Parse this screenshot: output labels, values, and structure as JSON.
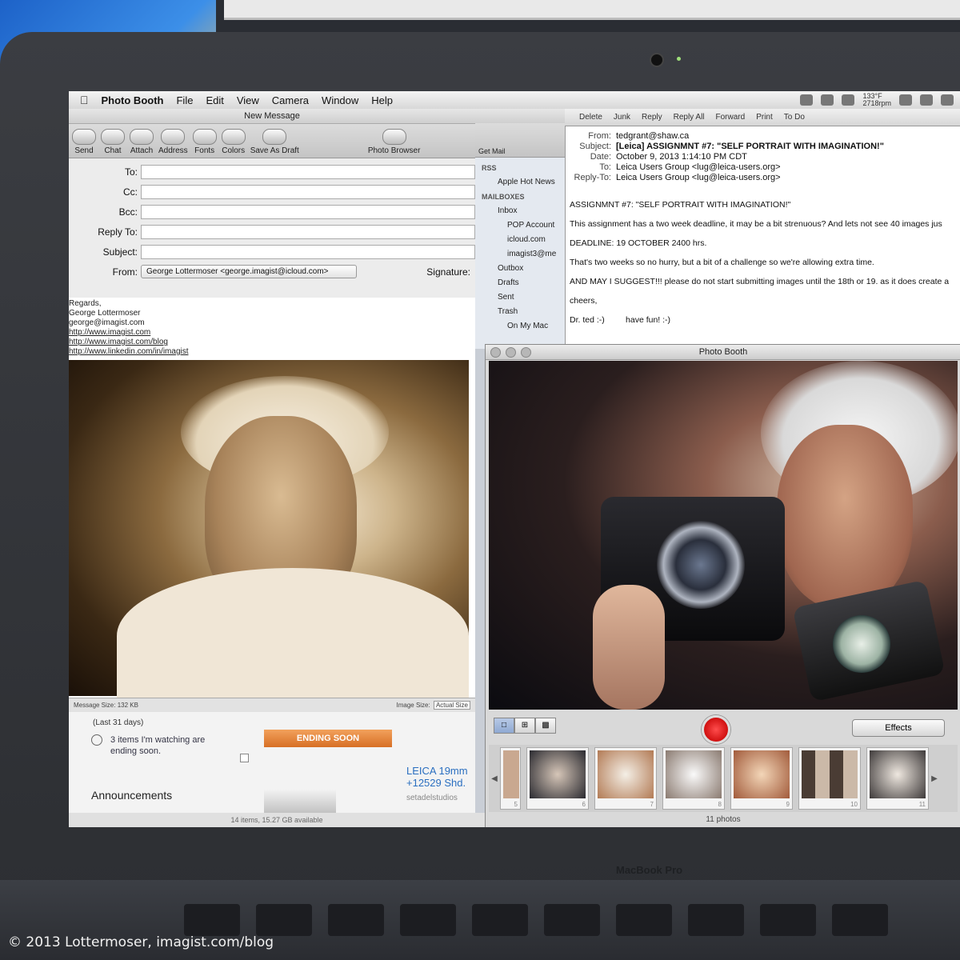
{
  "menubar": {
    "app": "Photo Booth",
    "items": [
      "File",
      "Edit",
      "View",
      "Camera",
      "Window",
      "Help"
    ],
    "status": [
      "133°F",
      "2718rpm"
    ]
  },
  "new_message": {
    "title": "New Message",
    "toolbar": [
      "Send",
      "Chat",
      "Attach",
      "Address",
      "Fonts",
      "Colors",
      "Save As Draft",
      "Photo Browser"
    ],
    "fields": {
      "to": "To:",
      "cc": "Cc:",
      "bcc": "Bcc:",
      "reply_to": "Reply To:",
      "subject": "Subject:",
      "from": "From:",
      "signature": "Signature:"
    },
    "from_value": "George Lottermoser <george.imagist@icloud.com>",
    "signature_lines": [
      "Regards,",
      "George Lottermoser",
      "george@imagist.com",
      "http://www.imagist.com",
      "http://www.imagist.com/blog",
      "http://www.linkedin.com/in/imagist"
    ],
    "footer": {
      "message_size": "Message Size: 132 KB",
      "image_size_label": "Image Size:",
      "image_size_value": "Actual Size"
    }
  },
  "webpage": {
    "period": "(Last 31 days)",
    "watching": "3 items I'm watching are ending soon.",
    "ending_button": "ENDING SOON",
    "announcements": "Announcements",
    "product_title": "LEICA 19mm +12529 Shd.",
    "seller": "setadelstudios",
    "disk_status": "14 items, 15.27 GB available"
  },
  "mail_viewer": {
    "get_mail": "Get Mail",
    "toolbar": [
      "Delete",
      "Junk",
      "Reply",
      "Reply All",
      "Forward",
      "Print",
      "To Do"
    ],
    "sidebar": [
      {
        "label": "RSS",
        "type": "head"
      },
      {
        "label": "Apple Hot News",
        "type": "item"
      },
      {
        "label": "MAILBOXES",
        "type": "head"
      },
      {
        "label": "Inbox",
        "type": "item"
      },
      {
        "label": "POP Account",
        "type": "sub"
      },
      {
        "label": "icloud.com",
        "type": "sub"
      },
      {
        "label": "imagist3@me",
        "type": "sub"
      },
      {
        "label": "Outbox",
        "type": "item"
      },
      {
        "label": "Drafts",
        "type": "item"
      },
      {
        "label": "Sent",
        "type": "item"
      },
      {
        "label": "Trash",
        "type": "item"
      },
      {
        "label": "On My Mac",
        "type": "sub"
      }
    ],
    "headers": {
      "from": "tedgrant@shaw.ca",
      "subject": "[Leica] ASSIGNMNT #7: \"SELF PORTRAIT WITH IMAGINATION!\"",
      "date": "October 9, 2013 1:14:10 PM CDT",
      "to": "Leica Users Group <lug@leica-users.org>",
      "reply_to": "Leica Users Group <lug@leica-users.org>"
    },
    "header_labels": {
      "from": "From:",
      "subject": "Subject:",
      "date": "Date:",
      "to": "To:",
      "reply_to": "Reply-To:"
    },
    "body": [
      "ASSIGNMNT #7: \"SELF PORTRAIT WITH IMAGINATION!\"",
      "This assignment has a two week deadline, it may be a bit strenuous?  And lets not see 40 images jus",
      "DEADLINE: 19 OCTOBER 2400 hrs.",
      "That's two weeks so no hurry, but a bit of a challenge so we're allowing extra time.",
      "AND MAY I SUGGEST!!! please do not start submitting images until the 18th or 19. as it does create a",
      "cheers,",
      "Dr. ted :-)         have fun! :-)"
    ]
  },
  "photo_booth": {
    "title": "Photo Booth",
    "effects": "Effects",
    "count": "11 photos",
    "thumb_numbers": [
      "5",
      "6",
      "7",
      "8",
      "9",
      "10",
      "11"
    ]
  },
  "laptop": {
    "brand": "MacBook Pro"
  },
  "credit": "© 2013 Lottermoser, imagist.com/blog"
}
